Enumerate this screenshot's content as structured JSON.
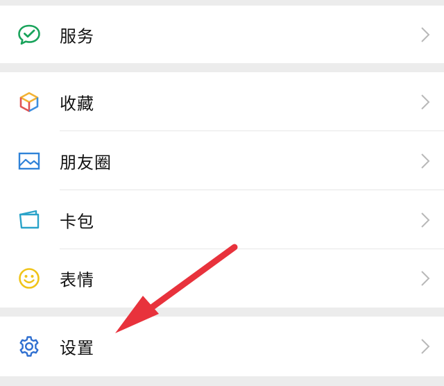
{
  "menu": {
    "services_label": "服务",
    "favorites_label": "收藏",
    "moments_label": "朋友圈",
    "cards_label": "卡包",
    "stickers_label": "表情",
    "settings_label": "设置"
  },
  "icons": {
    "services": "wechat-pay-check-icon",
    "favorites": "cube-icon",
    "moments": "picture-icon",
    "cards": "card-wallet-icon",
    "stickers": "smiley-icon",
    "settings": "gear-icon",
    "chevron": "chevron-right-icon"
  },
  "colors": {
    "background": "#ececec",
    "row_background": "#ffffff",
    "text": "#111111",
    "chevron": "#b8b8b8",
    "services_icon": "#19a35b",
    "moments_icon": "#2f82d8",
    "cards_icon": "#2aa3c9",
    "stickers_icon": "#f0c419",
    "settings_icon": "#2f6fd0",
    "annotation_arrow": "#e8323c"
  }
}
